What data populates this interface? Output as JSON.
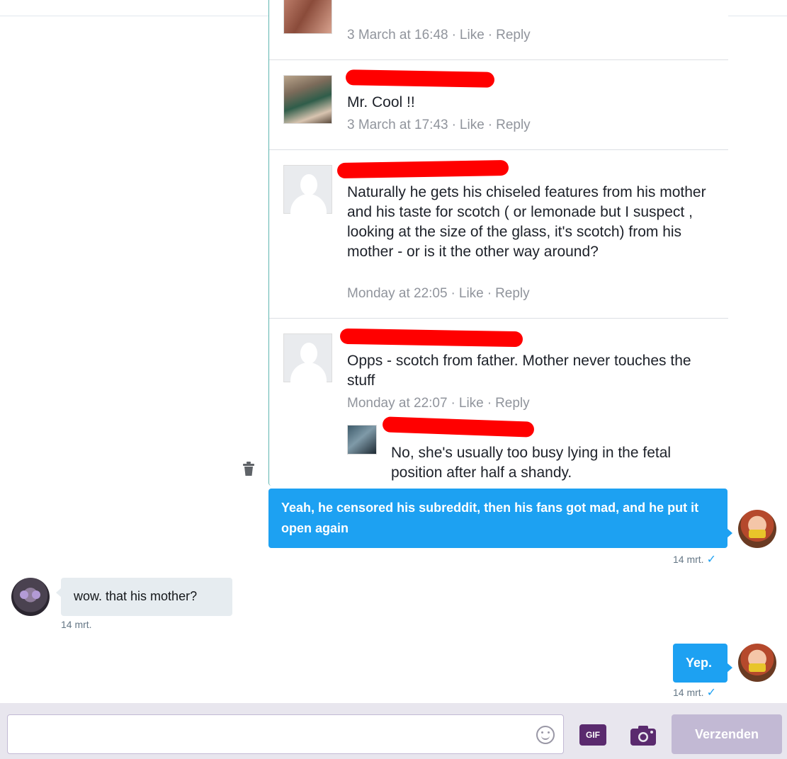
{
  "header": {
    "partial_title": ""
  },
  "screenshot": {
    "comments": [
      {
        "text": "",
        "meta_time": "3 March at 16:48",
        "like": "Like",
        "reply": "Reply"
      },
      {
        "text": "Mr. Cool !!",
        "meta_time": "3 March at 17:43",
        "like": "Like",
        "reply": "Reply"
      },
      {
        "text": "Naturally he gets his chiseled features from his mother and his taste for scotch ( or lemonade but I suspect , looking at the size of the glass, it's scotch) from his mother - or is it the other way around?",
        "meta_time": "Monday at 22:05",
        "like": "Like",
        "reply": "Reply"
      },
      {
        "text": "Opps - scotch from father. Mother never touches the stuff",
        "meta_time": "Monday at 22:07",
        "like": "Like",
        "reply": "Reply"
      }
    ],
    "reply": {
      "text": "No, she's usually too busy lying in the fetal position after half a shandy."
    },
    "separator": "·"
  },
  "messages": [
    {
      "direction": "out",
      "text": "Yeah, he censored his subreddit, then his fans got mad, and he put it open again",
      "time": "14 mrt.",
      "status": "✓"
    },
    {
      "direction": "in",
      "text": "wow. that his mother?",
      "time": "14 mrt."
    },
    {
      "direction": "out",
      "text": "Yep.",
      "time": "14 mrt.",
      "status": "✓"
    }
  ],
  "composer": {
    "placeholder": "",
    "gif_label": "GIF",
    "send_label": "Verzenden",
    "icons": [
      "emoji-icon",
      "gif-icon",
      "camera-icon",
      "trash-icon"
    ]
  },
  "colors": {
    "accent": "#1da1f2",
    "composer_bg": "#e8e6ee",
    "send_disabled": "#c2b9d4",
    "redaction": "#ff0000"
  }
}
